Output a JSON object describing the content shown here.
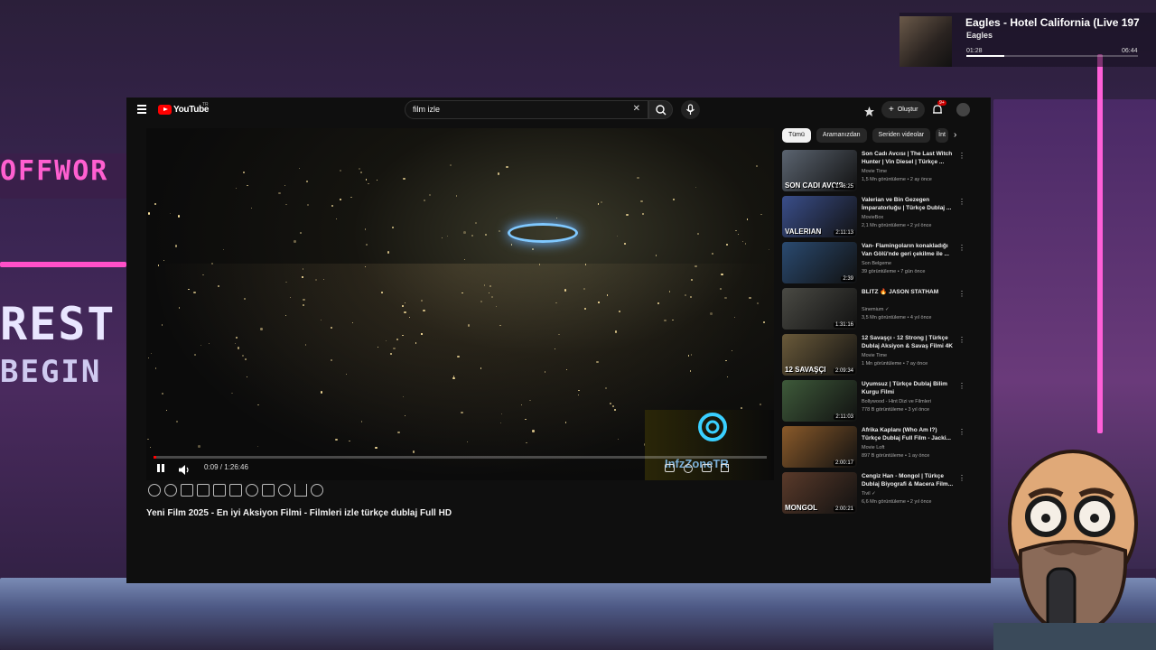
{
  "now_playing": {
    "title": "Eagles - Hotel California (Live 197",
    "artist": "Eagles",
    "current_time": "01:28",
    "total_time": "06:44",
    "progress": 0.22
  },
  "background": {
    "sign_1": "OFFWOR",
    "sign_2": "REST",
    "sign_3": "BEGIN"
  },
  "header": {
    "logo_text": "YouTube",
    "region": "TR",
    "search_value": "film izle",
    "create_label": "Oluştur",
    "notification_count": "9+"
  },
  "player": {
    "time": "0:09 / 1:26:46",
    "progress": 0.002,
    "watermark": "InfzZoneTR"
  },
  "video": {
    "title": "Yeni Film 2025 - En iyi Aksiyon Filmi - Filmleri izle türkçe dublaj Full HD"
  },
  "chips": [
    "Tümü",
    "Aramanızdan",
    "Seriden videolar",
    "İnt"
  ],
  "recommendations": [
    {
      "title": "Son Cadı Avcısı | The Last Witch Hunter | Vin Diesel | Türkçe ...",
      "channel": "Movie Time",
      "meta": "1,5 Mn görüntüleme • 2 ay önce",
      "duration": "1:46:25",
      "thumb_text": "SON CADI AVCIS",
      "color": "#5b6470"
    },
    {
      "title": "Valerian ve Bin Gezegen İmparatorluğu | Türkçe Dublaj ...",
      "channel": "MovieBox",
      "meta": "2,1 Mn görüntüleme • 2 yıl önce",
      "duration": "2:11:13",
      "thumb_text": "VALERIAN",
      "color": "#3a4e8a"
    },
    {
      "title": "Van- Flamingoların konakladığı Van Gölü'nde geri çekilme ile ...",
      "channel": "Son Belgeme",
      "meta": "39 görüntüleme • 7 gün önce",
      "duration": "2:39",
      "thumb_text": "",
      "color": "#2a4a70"
    },
    {
      "title": "BLITZ 🔥 JASON STATHAM",
      "channel": "Sinemium ✓",
      "meta": "3,5 Mn görüntüleme • 4 yıl önce",
      "duration": "1:31:16",
      "thumb_text": "",
      "color": "#4a4a44"
    },
    {
      "title": "12 Savaşçı - 12 Strong | Türkçe Dublaj Aksiyon & Savaş Filmi 4K",
      "channel": "Movie Time",
      "meta": "1 Mn görüntüleme • 7 ay önce",
      "duration": "2:09:34",
      "thumb_text": "12 SAVAŞÇI",
      "color": "#6a5a3a"
    },
    {
      "title": "Uyumsuz | Türkçe Dublaj Bilim Kurgu Filmi",
      "channel": "Bollywood - Hint Dizi ve Filmleri",
      "meta": "778 B görüntüleme • 3 yıl önce",
      "duration": "2:11:03",
      "thumb_text": "",
      "color": "#3e5a3a"
    },
    {
      "title": "Afrika Kaplanı (Who Am I?) Türkçe Dublaj Full Film - Jacki...",
      "channel": "Movie Loft",
      "meta": "897 B görüntüleme • 1 ay önce",
      "duration": "2:00:17",
      "thumb_text": "",
      "color": "#8a5a2a"
    },
    {
      "title": "Cengiz Han - Mongol | Türkçe Dublaj Biyografi & Macera Film...",
      "channel": "Tivil ✓",
      "meta": "6,6 Mn görüntüleme • 2 yıl önce",
      "duration": "2:00:21",
      "thumb_text": "MONGOL",
      "color": "#5a3a2a"
    }
  ]
}
